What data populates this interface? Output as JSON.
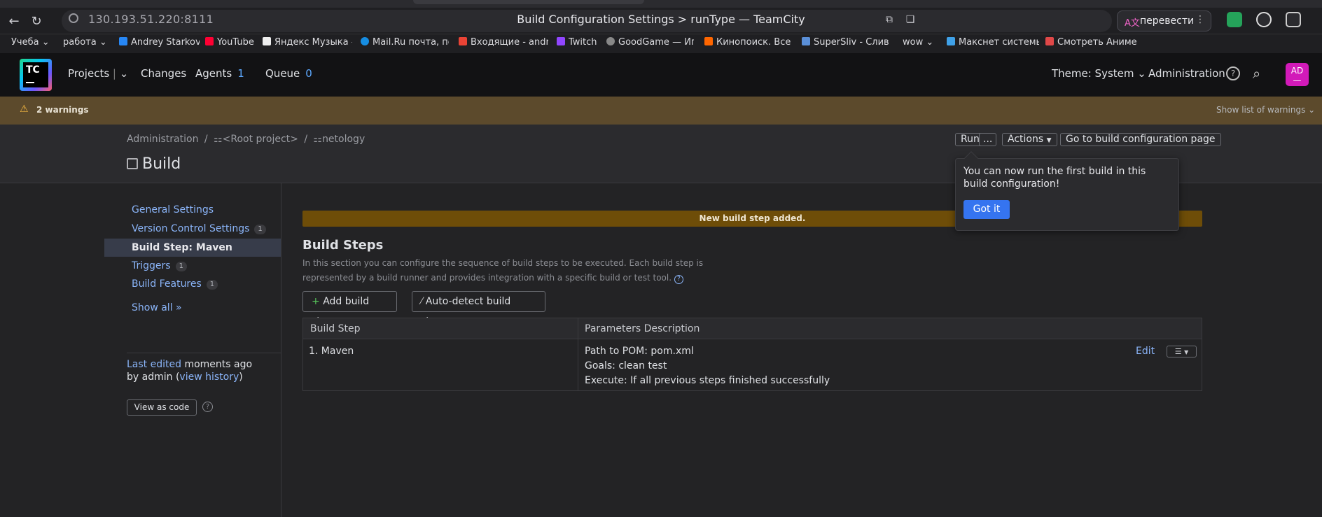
{
  "browser": {
    "url": "130.193.51.220:8111",
    "tab_title": "Build Configuration Settings > runType — TeamCity",
    "translate_label": "перевести",
    "bookmarks": [
      {
        "label": "Учеба",
        "icon": "folder-icon"
      },
      {
        "label": "работа",
        "icon": "folder-icon"
      },
      {
        "label": "Andrey Starkov",
        "icon": "vk-icon"
      },
      {
        "label": "YouTube",
        "icon": "youtube-icon"
      },
      {
        "label": "Яндекс Музыка —",
        "icon": "yandex-music-icon"
      },
      {
        "label": "Mail.Ru почта, по",
        "icon": "mailru-icon"
      },
      {
        "label": "Входящие - andru",
        "icon": "gmail-icon"
      },
      {
        "label": "Twitch",
        "icon": "twitch-icon"
      },
      {
        "label": "GoodGame — Игр",
        "icon": "goodgame-icon"
      },
      {
        "label": "Кинопоиск. Все ф",
        "icon": "kinopoisk-icon"
      },
      {
        "label": "SuperSliv - Слив I",
        "icon": "supersliv-icon"
      },
      {
        "label": "wow",
        "icon": "folder-icon"
      },
      {
        "label": "Макснет системы",
        "icon": "maxnet-icon"
      },
      {
        "label": "Смотреть Аниме",
        "icon": "anime-icon"
      }
    ]
  },
  "header": {
    "logo_text": "TC",
    "projects": "Projects",
    "changes": "Changes",
    "agents": "Agents",
    "agents_count": "1",
    "queue": "Queue",
    "queue_count": "0",
    "theme": "Theme: System",
    "administration": "Administration",
    "avatar": "AD"
  },
  "warnings": {
    "text": "2 warnings",
    "show": "Show list of warnings"
  },
  "breadcrumb": {
    "root": "Administration",
    "sep": "/",
    "project1": "<Root project>",
    "project2": "netology"
  },
  "page_title": "Build",
  "toolbar": {
    "run": "Run",
    "more": "...",
    "actions": "Actions",
    "goto": "Go to build configuration page"
  },
  "popup": {
    "text": "You can now run the first build in this build configuration!",
    "button": "Got it"
  },
  "sidebar": {
    "items": [
      {
        "label": "General Settings",
        "badge": ""
      },
      {
        "label": "Version Control Settings",
        "badge": "1"
      },
      {
        "label": "Build Step: Maven",
        "badge": ""
      },
      {
        "label": "Triggers",
        "badge": "1"
      },
      {
        "label": "Build Features",
        "badge": "1"
      }
    ],
    "show_all": "Show all »",
    "last_edited_link": "Last edited",
    "last_edited_rest": " moments ago",
    "by": "by admin  (",
    "view_history": "view history",
    "close_paren": ")",
    "view_as_code": "View as code"
  },
  "main": {
    "banner": "New build step added.",
    "heading": "Build Steps",
    "description": "In this section you can configure the sequence of build steps to be executed. Each build step is represented by a build runner and provides integration with a specific build or test tool.",
    "add_step": "Add build step",
    "auto_detect": "Auto-detect build steps",
    "table": {
      "headers": [
        "Build Step",
        "Parameters Description"
      ],
      "rows": [
        {
          "step": "1. Maven",
          "params": [
            "Path to POM: pom.xml",
            "Goals: clean test",
            "Execute: If all previous steps finished successfully"
          ],
          "edit": "Edit"
        }
      ]
    }
  }
}
